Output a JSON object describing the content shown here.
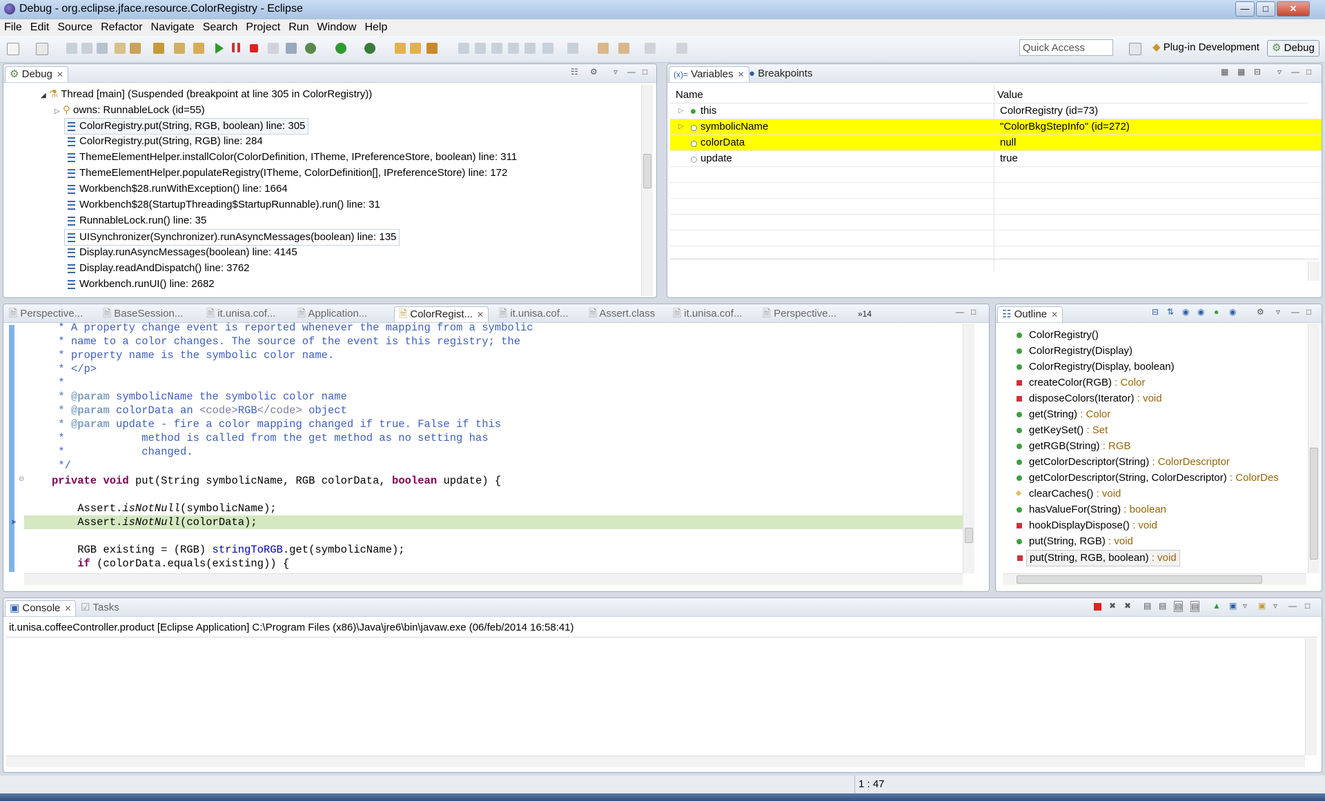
{
  "window": {
    "title": "Debug - org.eclipse.jface.resource.ColorRegistry - Eclipse"
  },
  "menu": [
    "File",
    "Edit",
    "Source",
    "Refactor",
    "Navigate",
    "Search",
    "Project",
    "Run",
    "Window",
    "Help"
  ],
  "toolbar": {
    "quick_access_placeholder": "Quick Access"
  },
  "perspectives": {
    "plugin": "Plug-in Development",
    "debug": "Debug"
  },
  "debug_view": {
    "tab": "Debug",
    "thread": "Thread [main] (Suspended (breakpoint at line 305 in ColorRegistry))",
    "owns": "owns: RunnableLock  (id=55)",
    "frames": [
      "ColorRegistry.put(String, RGB, boolean) line: 305",
      "ColorRegistry.put(String, RGB) line: 284",
      "ThemeElementHelper.installColor(ColorDefinition, ITheme, IPreferenceStore, boolean) line: 311",
      "ThemeElementHelper.populateRegistry(ITheme, ColorDefinition[], IPreferenceStore) line: 172",
      "Workbench$28.runWithException() line: 1664",
      "Workbench$28(StartupThreading$StartupRunnable).run() line: 31",
      "RunnableLock.run() line: 35",
      "UISynchronizer(Synchronizer).runAsyncMessages(boolean) line: 135",
      "Display.runAsyncMessages(boolean) line: 4145",
      "Display.readAndDispatch() line: 3762",
      "Workbench.runUI() line: 2682"
    ]
  },
  "variables_view": {
    "tabs": [
      "Variables",
      "Breakpoints"
    ],
    "columns": [
      "Name",
      "Value"
    ],
    "rows": [
      {
        "name": "this",
        "value": "ColorRegistry  (id=73)"
      },
      {
        "name": "symbolicName",
        "value": "\"ColorBkgStepInfo\" (id=272)"
      },
      {
        "name": "colorData",
        "value": "null"
      },
      {
        "name": "update",
        "value": "true"
      }
    ]
  },
  "editor": {
    "tabs": [
      "Perspective...",
      "BaseSession...",
      "it.unisa.cof...",
      "Application...",
      "ColorRegist...",
      "it.unisa.cof...",
      "Assert.class",
      "it.unisa.cof...",
      "Perspective..."
    ],
    "overflow": "»14",
    "lines": {
      "l1": " * A property change event is reported whenever the mapping from a symbolic",
      "l2": " * name to a color changes. The source of the event is this registry; the",
      "l3": " * property name is the symbolic color name.",
      "l4": " * </p>",
      "l5": " *",
      "l6a": " * @param",
      "l6b": " symbolicName the symbolic color name",
      "l7a": " * @param",
      "l7b": " colorData an ",
      "l7c": "<code>",
      "l7d": "RGB",
      "l7e": "</code>",
      "l7f": " object",
      "l8a": " * @param",
      "l8b": " update - fire a color mapping changed if true. False if this",
      "l9": " *            method is called from the get method as no setting has",
      "l10": " *            changed.",
      "l11": " */",
      "l12a": "private",
      "l12b": "void",
      "l12c": " put(String symbolicName, RGB colorData, ",
      "l12d": "boolean",
      "l12e": " update) {",
      "l13a": "    Assert.",
      "l13b": "isNotNull",
      "l13c": "(symbolicName);",
      "l14a": "    Assert.",
      "l14b": "isNotNull",
      "l14c": "(colorData);",
      "l15a": "    RGB existing = (RGB) ",
      "l15b": "stringToRGB",
      "l15c": ".get(symbolicName);",
      "l16a": "    ",
      "l16b": "if",
      "l16c": " (colorData.equals(existing)) {"
    }
  },
  "outline_view": {
    "tab": "Outline",
    "items": [
      {
        "name": "ColorRegistry()",
        "type": ""
      },
      {
        "name": "ColorRegistry(Display)",
        "type": ""
      },
      {
        "name": "ColorRegistry(Display, boolean)",
        "type": ""
      },
      {
        "name": "createColor(RGB)",
        "type": " : Color"
      },
      {
        "name": "disposeColors(Iterator)",
        "type": " : void"
      },
      {
        "name": "get(String)",
        "type": " : Color"
      },
      {
        "name": "getKeySet()",
        "type": " : Set"
      },
      {
        "name": "getRGB(String)",
        "type": " : RGB"
      },
      {
        "name": "getColorDescriptor(String)",
        "type": " : ColorDescriptor"
      },
      {
        "name": "getColorDescriptor(String, ColorDescriptor)",
        "type": " : ColorDes"
      },
      {
        "name": "clearCaches()",
        "type": " : void"
      },
      {
        "name": "hasValueFor(String)",
        "type": " : boolean"
      },
      {
        "name": "hookDisplayDispose()",
        "type": " : void"
      },
      {
        "name": "put(String, RGB)",
        "type": " : void"
      },
      {
        "name": "put(String, RGB, boolean)",
        "type": " : void"
      }
    ]
  },
  "console_view": {
    "tabs": [
      "Console",
      "Tasks"
    ],
    "header": "it.unisa.coffeeController.product [Eclipse Application] C:\\Program Files (x86)\\Java\\jre6\\bin\\javaw.exe (06/feb/2014 16:58:41)"
  },
  "status": {
    "position": "1 : 47"
  },
  "colors": {
    "highlight": "#ffff00",
    "current_line": "#d4e8c2",
    "keyword": "#7f0055",
    "comment": "#3f5fbf"
  }
}
